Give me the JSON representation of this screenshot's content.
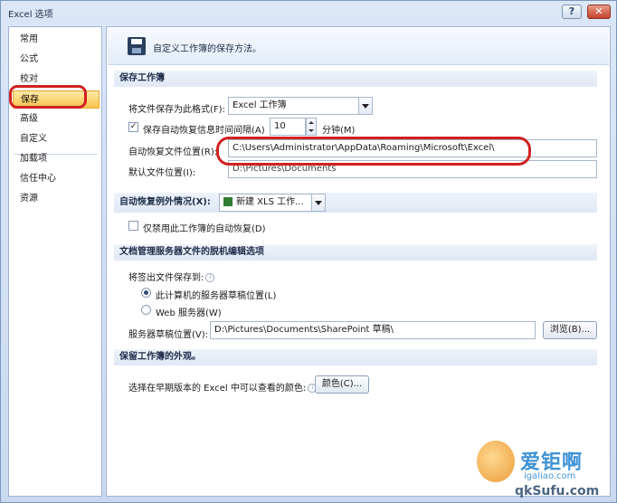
{
  "window": {
    "title": "Excel 选项"
  },
  "nav": {
    "items": [
      {
        "label": "常用"
      },
      {
        "label": "公式"
      },
      {
        "label": "校对"
      },
      {
        "label": "保存"
      },
      {
        "label": "高级"
      },
      {
        "label": "自定义"
      },
      {
        "label": "加载项"
      },
      {
        "label": "信任中心"
      },
      {
        "label": "资源"
      }
    ],
    "selected": "保存"
  },
  "header": {
    "text": "自定义工作簿的保存方法。"
  },
  "save_workbooks": {
    "title": "保存工作簿",
    "format_label": "将文件保存为此格式(F):",
    "format_value": "Excel 工作簿",
    "autorecover_label": "保存自动恢复信息时间间隔(A)",
    "autorecover_checked": "✓",
    "autorecover_minutes": "10",
    "minutes_label": "分钟(M)",
    "autorecover_location_label": "自动恢复文件位置(R):",
    "autorecover_location_value": "C:\\Users\\Administrator\\AppData\\Roaming\\Microsoft\\Excel\\",
    "default_location_label": "默认文件位置(I):",
    "default_location_value": "D:\\Pictures\\Documents"
  },
  "autorecover_exceptions": {
    "title": "自动恢复例外情况(X):",
    "workbook_value": "新建 XLS 工作...",
    "disable_label": "仅禁用此工作簿的自动恢复(D)"
  },
  "offline_editing": {
    "title": "文档管理服务器文件的脱机编辑选项",
    "save_to_label": "将签出文件保存到:",
    "option_local": "此计算机的服务器草稿位置(L)",
    "option_web": "Web 服务器(W)",
    "drafts_label": "服务器草稿位置(V):",
    "drafts_value": "D:\\Pictures\\Documents\\SharePoint 草稿\\",
    "browse_button": "浏览(B)..."
  },
  "appearance": {
    "title": "保留工作簿的外观。",
    "colors_label": "选择在早期版本的 Excel 中可以查看的颜色:",
    "colors_button": "颜色(C)..."
  },
  "watermark": {
    "line1": "爱钜啊",
    "line2": "igaliao.com",
    "line3": "qkSufu.com"
  }
}
